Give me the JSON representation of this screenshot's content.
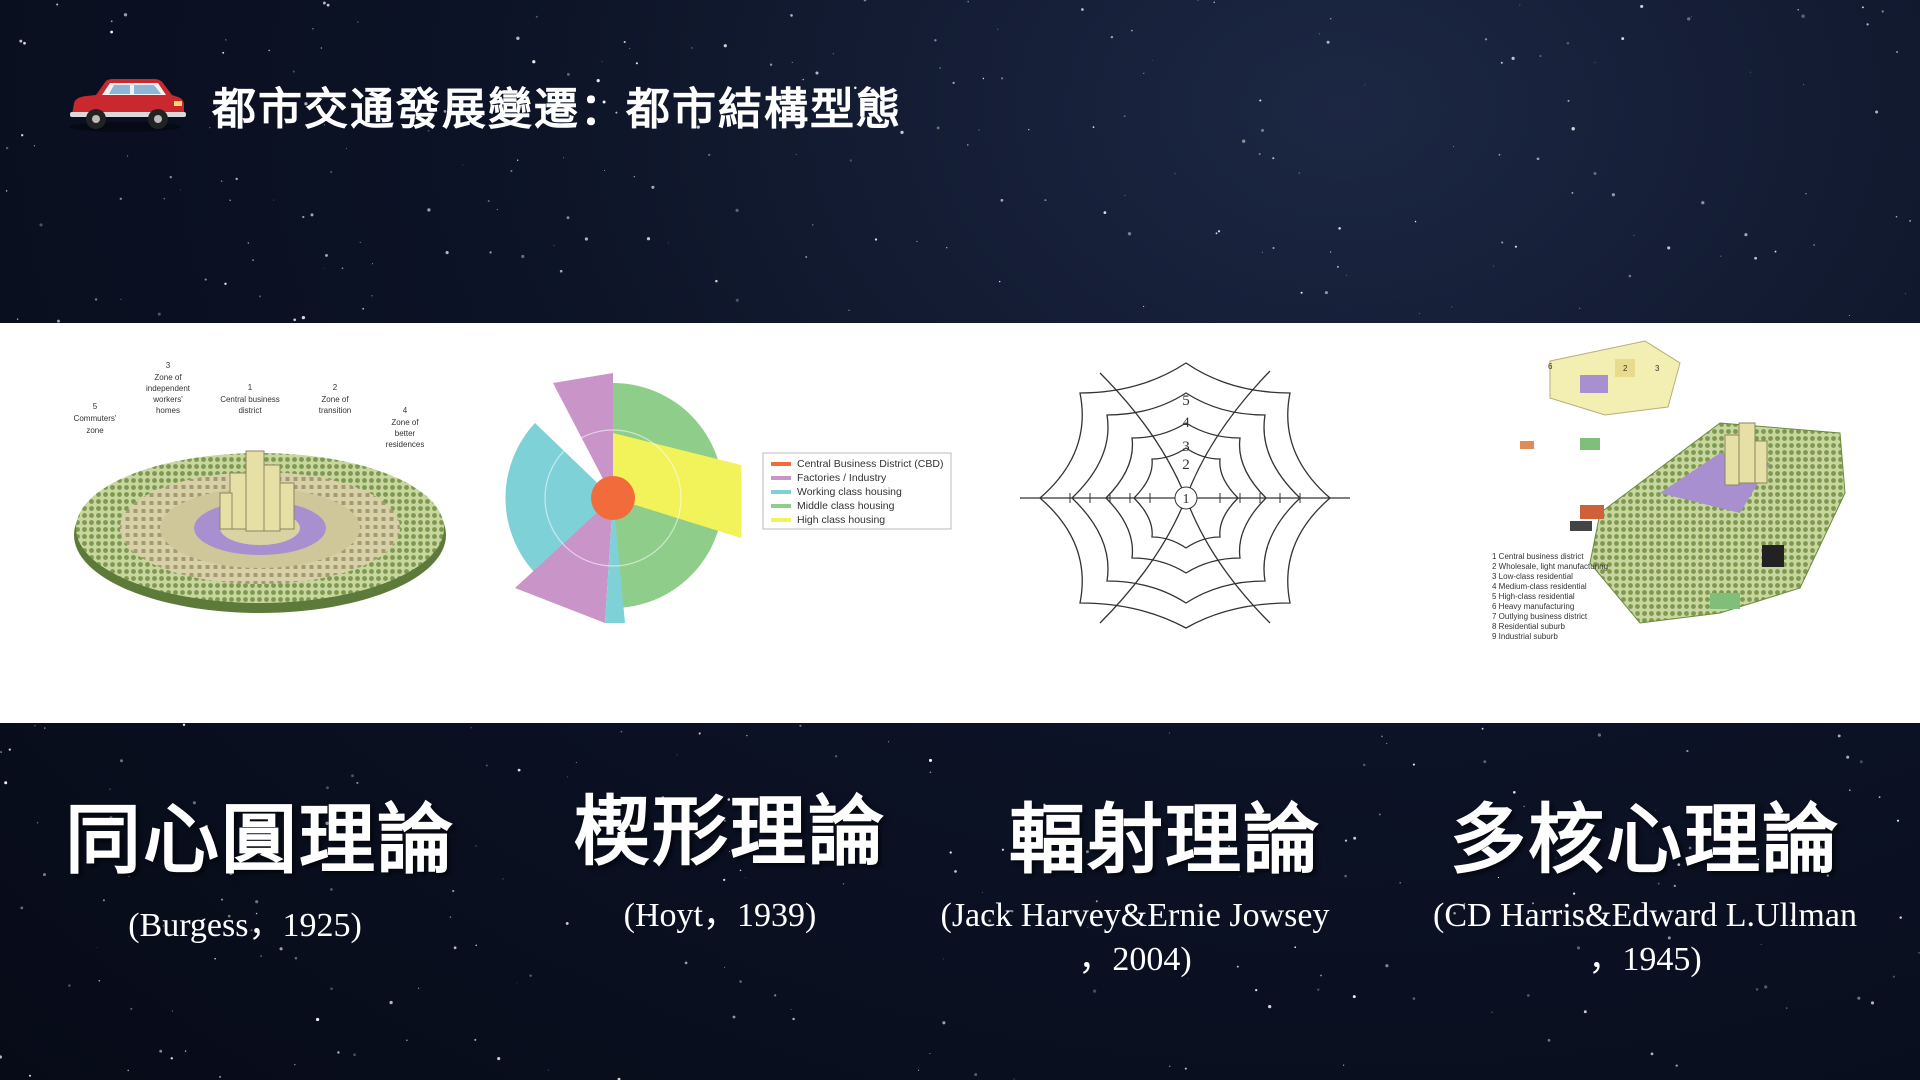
{
  "header": {
    "title": "都市交通發展變遷：都市結構型態",
    "icon": "car-icon",
    "icon_color": "#c8282e"
  },
  "burgess": {
    "labels": [
      {
        "num": "5",
        "text": [
          "Commuters'",
          "zone"
        ]
      },
      {
        "num": "3",
        "text": [
          "Zone of",
          "independent",
          "workers'",
          "homes"
        ]
      },
      {
        "num": "1",
        "text": [
          "Central business",
          "district"
        ]
      },
      {
        "num": "2",
        "text": [
          "Zone of",
          "transition"
        ]
      },
      {
        "num": "4",
        "text": [
          "Zone of",
          "better",
          "residences"
        ]
      }
    ]
  },
  "hoyt": {
    "legend": [
      {
        "label": "Central Business District (CBD)",
        "color": "#f26b3a"
      },
      {
        "label": "Factories / Industry",
        "color": "#c994c7"
      },
      {
        "label": "Working class housing",
        "color": "#7fd1d8"
      },
      {
        "label": "Middle class housing",
        "color": "#8fce8a"
      },
      {
        "label": "High class housing",
        "color": "#f2f25a"
      }
    ]
  },
  "radial": {
    "rings": [
      "5",
      "4",
      "3",
      "2",
      "1"
    ]
  },
  "multi": {
    "legend": [
      "1  Central business district",
      "2  Wholesale, light manufacturing",
      "3  Low-class residential",
      "4  Medium-class residential",
      "5  High-class residential",
      "6  Heavy manufacturing",
      "7  Outlying business district",
      "8  Residential suburb",
      "9  Industrial suburb"
    ]
  },
  "theories": [
    {
      "name": "同心圓理論",
      "cite": [
        "(Burgess，1925)"
      ]
    },
    {
      "name": "楔形理論",
      "cite": [
        "(Hoyt，1939)"
      ]
    },
    {
      "name": "輻射理論",
      "cite": [
        "(Jack Harvey&Ernie Jowsey",
        "，2004)"
      ]
    },
    {
      "name": "多核心理論",
      "cite": [
        "(CD Harris&Edward L.Ullman",
        "，1945)"
      ]
    }
  ]
}
